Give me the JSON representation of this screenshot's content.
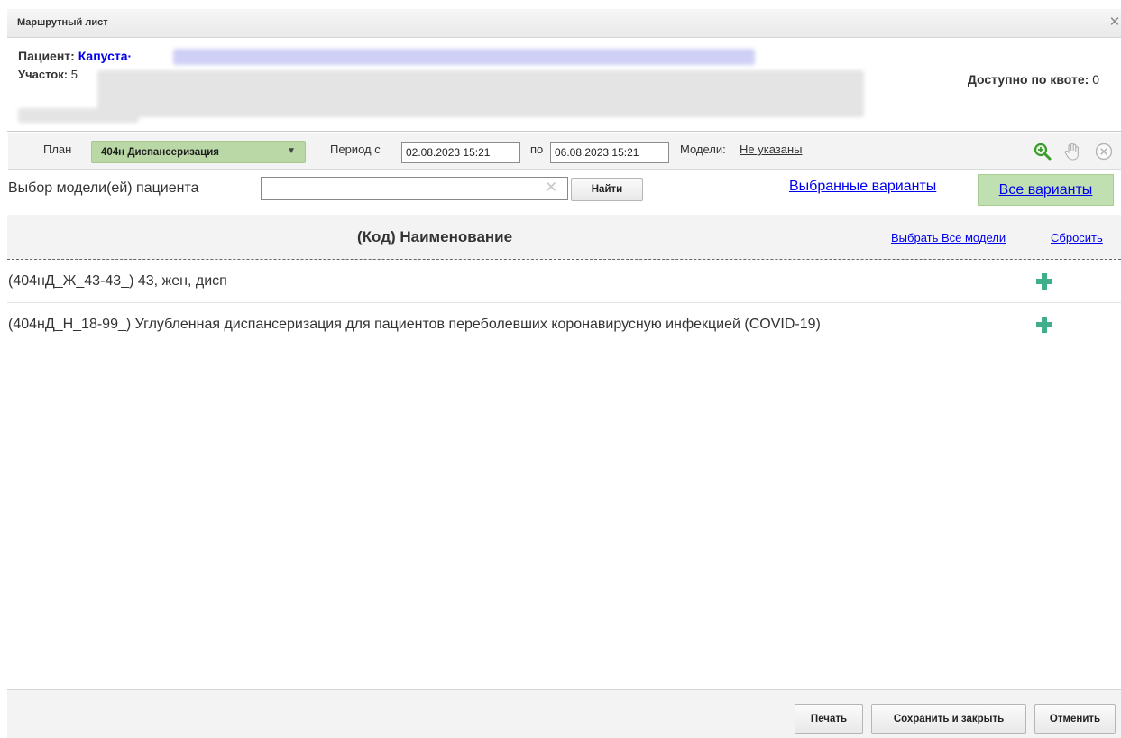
{
  "window": {
    "title": "Маршрутный лист"
  },
  "patient": {
    "label": "Пациент:",
    "name": "Капуста·",
    "district_label": "Участок:",
    "district_value": "5",
    "quota_label": "Доступно по квоте:",
    "quota_value": "0"
  },
  "toolbar": {
    "plan_label": "План",
    "plan_value": "404н Диспансеризация",
    "period_from_label": "Период с",
    "date_from": "02.08.2023 15:21",
    "period_to_label": "по",
    "date_to": "06.08.2023 15:21",
    "models_label": "Модели:",
    "models_value": "Не указаны"
  },
  "filter": {
    "label": "Выбор модели(ей) пациента",
    "search_value": "",
    "find_button": "Найти",
    "selected_variants": "Выбранные варианты",
    "all_variants": "Все варианты"
  },
  "table": {
    "column": "(Код) Наименование",
    "select_all": "Выбрать Все модели",
    "reset": "Сбросить",
    "rows": [
      {
        "text": "(404нД_Ж_43-43_) 43, жен, дисп"
      },
      {
        "text": "(404нД_Н_18-99_) Углубленная диспансеризация для пациентов переболевших коронавирусную инфекцией (COVID-19)"
      }
    ]
  },
  "footer": {
    "print": "Печать",
    "save_close": "Сохранить и закрыть",
    "cancel": "Отменить"
  },
  "colors": {
    "link": "#0000ee",
    "plan_select_bg": "#b9d8a6",
    "all_variants_bg": "#c1e0b1",
    "add_icon": "#3fae8a",
    "zoom_icon": "#3a9b2e"
  },
  "icons": {
    "close": "close-icon",
    "zoom": "zoom-in-icon",
    "hand": "hand-icon",
    "remove": "remove-circle-icon",
    "clear": "clear-x-icon",
    "add": "plus-icon"
  }
}
